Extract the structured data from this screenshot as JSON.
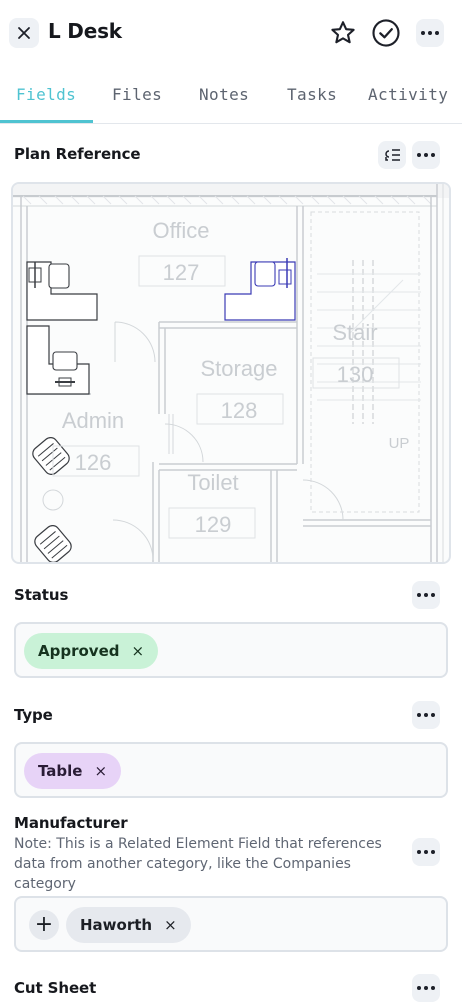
{
  "header": {
    "title": "L Desk",
    "close_icon": "close-icon",
    "star_icon": "star-icon",
    "check_icon": "check-circle-icon",
    "more_icon": "more-icon"
  },
  "tabs": [
    {
      "label": "Fields",
      "active": true
    },
    {
      "label": "Files",
      "active": false
    },
    {
      "label": "Notes",
      "active": false
    },
    {
      "label": "Tasks",
      "active": false
    },
    {
      "label": "Activity",
      "active": false
    }
  ],
  "plan_reference": {
    "label": "Plan Reference",
    "rooms": [
      {
        "name": "Office",
        "number": "127"
      },
      {
        "name": "Storage",
        "number": "128"
      },
      {
        "name": "Stair",
        "number": "130"
      },
      {
        "name": "Admin",
        "number": "126"
      },
      {
        "name": "Toilet",
        "number": "129"
      }
    ],
    "stair_marker": "UP"
  },
  "status": {
    "label": "Status",
    "chip": "Approved",
    "chip_color": "#c9f2d7"
  },
  "type": {
    "label": "Type",
    "chip": "Table",
    "chip_color": "#e7d3f7"
  },
  "manufacturer": {
    "label": "Manufacturer",
    "note": "Note: This is a Related Element Field that references data from another category, like the Companies category",
    "chip": "Haworth",
    "add_symbol": "+"
  },
  "cut_sheet": {
    "label": "Cut Sheet"
  },
  "chip_remove_symbol": "×",
  "colors": {
    "accent": "#4fc3d1",
    "selected_desk": "#3b3bb5"
  }
}
